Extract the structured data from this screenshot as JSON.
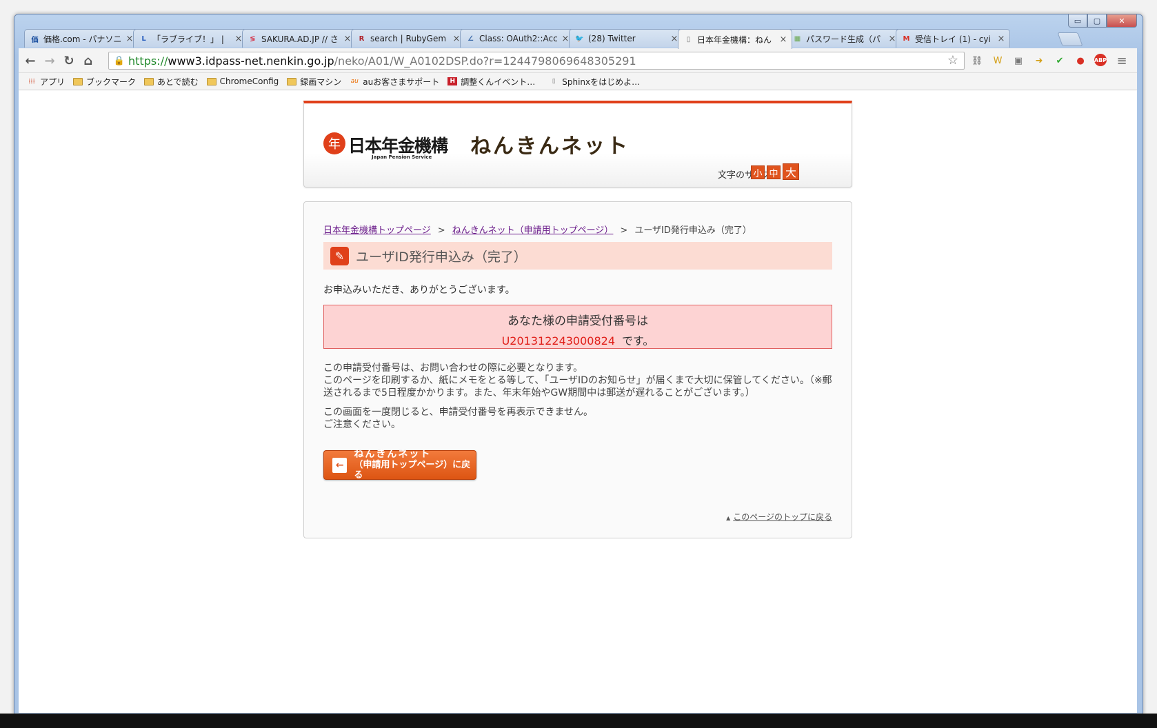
{
  "window": {
    "controls": {
      "minimize": "▭",
      "maximize": "▢",
      "close": "✕"
    }
  },
  "tabs": [
    {
      "title": "価格.com - パナソニ",
      "icon": "kakaku-icon",
      "icon_char": "価",
      "icon_color": "#1a4fa0"
    },
    {
      "title": "「ラブライブ！」 |",
      "icon": "lovelive-icon",
      "icon_char": "L",
      "icon_color": "#2a5fbe"
    },
    {
      "title": "SAKURA.AD.JP // さ",
      "icon": "sakura-icon",
      "icon_char": "≶",
      "icon_color": "#d4344a"
    },
    {
      "title": "search | RubyGem",
      "icon": "rubygems-icon",
      "icon_char": "R",
      "icon_color": "#b0232a"
    },
    {
      "title": "Class: OAuth2::Acc",
      "icon": "rdoc-icon",
      "icon_char": "∠",
      "icon_color": "#3d6aa8"
    },
    {
      "title": "(28) Twitter",
      "icon": "twitter-icon",
      "icon_char": "🐦",
      "icon_color": "#3ba9e6"
    },
    {
      "title": "日本年金機構：ねん",
      "icon": "page-icon",
      "icon_char": "▯",
      "icon_color": "#777777",
      "active": true
    },
    {
      "title": "パスワード生成（パ",
      "icon": "password-icon",
      "icon_char": "▦",
      "icon_color": "#6aa84f"
    },
    {
      "title": "受信トレイ (1) - cyi",
      "icon": "gmail-icon",
      "icon_char": "M",
      "icon_color": "#d93025"
    }
  ],
  "toolbar": {
    "back": "←",
    "forward": "→",
    "reload": "↻",
    "home": "⌂",
    "url_scheme": "https://",
    "url_host": "www3.idpass-net.nenkin.go.jp",
    "url_path": "/neko/A01/W_A0102DSP.do?r=1244798069648305291",
    "star": "☆",
    "extensions": [
      {
        "name": "ext-puzzle-icon",
        "char": "⛓",
        "color": "#555555"
      },
      {
        "name": "ext-w-icon",
        "char": "W",
        "color": "#d4a017"
      },
      {
        "name": "ext-screen-icon",
        "char": "▣",
        "color": "#777777"
      },
      {
        "name": "ext-arrow-icon",
        "char": "➜",
        "color": "#d4a017"
      },
      {
        "name": "ext-check-icon",
        "char": "✔",
        "color": "#2ea82e"
      },
      {
        "name": "ext-record-icon",
        "char": "●",
        "color": "#d93025"
      },
      {
        "name": "adblock-icon",
        "char": "ABP",
        "color": "#d93025"
      },
      {
        "name": "menu-icon",
        "char": "≡",
        "color": "#555555"
      }
    ]
  },
  "bookmarks": [
    {
      "label": "アプリ",
      "icon": "apps-icon"
    },
    {
      "label": "ブックマーク",
      "icon": "folder-icon"
    },
    {
      "label": "あとで読む",
      "icon": "folder-icon"
    },
    {
      "label": "ChromeConfig",
      "icon": "folder-icon"
    },
    {
      "label": "録画マシン",
      "icon": "folder-icon"
    },
    {
      "label": "auお客さまサポート",
      "icon": "au-icon"
    },
    {
      "label": "調整くんイベント…",
      "icon": "chouseikun-icon"
    },
    {
      "label": "Sphinxをはじめよ…",
      "icon": "page-icon"
    }
  ],
  "header": {
    "logo_mark": "年",
    "logo_text": "日本年金機構",
    "logo_sub": "Japan Pension Service",
    "site_name": "ねんきんネット",
    "font_size_label": "文字のサイズ",
    "font_sizes": [
      "小",
      "中",
      "大"
    ]
  },
  "breadcrumb": {
    "items": [
      "日本年金機構トップページ",
      "ねんきんネット（申請用トップページ）"
    ],
    "current": "ユーザID発行申込み（完了）",
    "separator": ">"
  },
  "main": {
    "title": "ユーザID発行申込み（完了）",
    "title_icon": "✎",
    "intro": "お申込みいただき、ありがとうございます。",
    "receipt_heading": "あなた様の申請受付番号は",
    "receipt_number": "U201312243000824",
    "receipt_suffix": "です。",
    "notes": [
      "この申請受付番号は、お問い合わせの際に必要となります。",
      "このページを印刷するか、紙にメモをとる等して、「ユーザIDのお知らせ」が届くまで大切に保管してください。（※郵送されるまで5日程度かかります。また、年末年始やGW期間中は郵送が遅れることがございます。）",
      "この画面を一度閉じると、申請受付番号を再表示できません。",
      "ご注意ください。"
    ],
    "back_button_line1": "ねんきんネット",
    "back_button_line2": "（申請用トップページ）に戻る",
    "back_arrow": "←",
    "to_top_marker": "▲",
    "to_top": "このページのトップに戻る"
  }
}
